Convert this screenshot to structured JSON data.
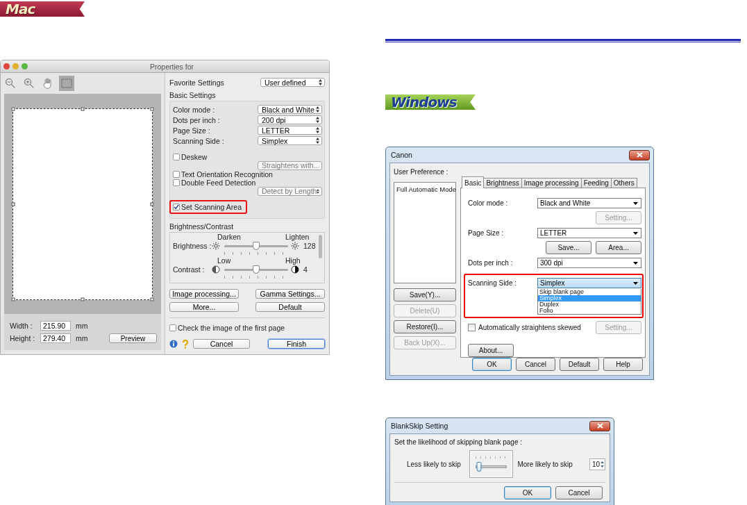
{
  "mac": {
    "badge": {
      "kind": "mac",
      "label": "Mac"
    },
    "dialog": {
      "title": "Properties for",
      "tools": [
        {
          "kind": "zoom_out",
          "selected": false
        },
        {
          "kind": "zoom_in",
          "selected": false
        },
        {
          "kind": "hand",
          "selected": false
        },
        {
          "kind": "select_area",
          "selected": true
        }
      ],
      "size_fields": [
        {
          "label": "Width :",
          "value": "215.90",
          "unit": "mm"
        },
        {
          "label": "Height :",
          "value": "279.40",
          "unit": "mm"
        }
      ],
      "preview_button": "Preview",
      "favorite": {
        "label": "Favorite Settings",
        "value": "User defined"
      },
      "basic_settings": {
        "title": "Basic Settings",
        "popups": [
          {
            "label": "Color mode :",
            "value": "Black and White"
          },
          {
            "label": "Dots per inch :",
            "value": "200 dpi"
          },
          {
            "label": "Page Size :",
            "value": "LETTER"
          },
          {
            "label": "Scanning Side :",
            "value": "Simplex"
          }
        ],
        "options": [
          {
            "kind": "checkbox",
            "label": "Deskew",
            "checked": false
          },
          {
            "kind": "popup",
            "value": "Straightens with...",
            "disabled": true
          },
          {
            "kind": "checkbox",
            "label": "Text Orientation Recognition",
            "checked": false
          },
          {
            "kind": "checkbox",
            "label": "Double Feed Detection",
            "checked": false
          },
          {
            "kind": "popup",
            "value": "Detect by Length",
            "disabled": true
          }
        ]
      },
      "scan_area": {
        "label": "Set Scanning Area",
        "checked": true,
        "highlight": true
      },
      "brightness_contrast": {
        "title": "Brightness/Contrast",
        "sliders": [
          {
            "kind": "brightness",
            "label": "Brightness :",
            "low": "Darken",
            "high": "Lighten",
            "level": 0.5,
            "reading": "128"
          },
          {
            "kind": "contrast",
            "label": "Contrast :",
            "low": "Low",
            "high": "High",
            "level": 0.5,
            "reading": "4"
          }
        ]
      },
      "buttons": [
        {
          "label": "Image processing...",
          "default": false
        },
        {
          "label": "Gamma Settings...",
          "default": false
        },
        {
          "label": "More...",
          "default": false
        },
        {
          "label": "Default",
          "default": false
        }
      ],
      "first_page_check": {
        "label": "Check the image of the first page",
        "checked": false
      },
      "footer_buttons": [
        {
          "label": "Cancel",
          "default": false
        },
        {
          "label": "Finish",
          "default": true
        }
      ]
    }
  },
  "windows": {
    "badge": {
      "kind": "windows",
      "label": "Windows"
    },
    "dialog": {
      "title": "Canon",
      "user_preference": {
        "label": "User Preference :",
        "items": [
          {
            "label": "Full Automatic Mode",
            "selected": false
          }
        ]
      },
      "side_buttons": [
        {
          "label": "Save(Y)...",
          "disabled": false
        },
        {
          "label": "Delete(U)",
          "disabled": true
        },
        {
          "label": "Restore(I)...",
          "disabled": false
        },
        {
          "label": "Back Up(X)...",
          "disabled": true
        }
      ],
      "tabs": [
        {
          "label": "Basic",
          "selected": true
        },
        {
          "label": "Brightness",
          "selected": false
        },
        {
          "label": "Image processing",
          "selected": false
        },
        {
          "label": "Feeding",
          "selected": false
        },
        {
          "label": "Others",
          "selected": false
        }
      ],
      "color_mode": {
        "label": "Color mode :",
        "value": "Black and White"
      },
      "color_setting_button": {
        "label": "Setting...",
        "disabled": true
      },
      "page_size": {
        "label": "Page Size :",
        "value": "LETTER"
      },
      "page_size_buttons": [
        {
          "label": "Save...",
          "disabled": false
        },
        {
          "label": "Area...",
          "disabled": false
        }
      ],
      "dpi": {
        "label": "Dots per inch :",
        "value": "300 dpi"
      },
      "scanning_side": {
        "label": "Scanning Side :",
        "value": "Simplex",
        "highlight": true,
        "options": [
          {
            "label": "Skip blank page",
            "selected": false
          },
          {
            "label": "Simplex",
            "selected": true
          },
          {
            "label": "Duplex",
            "selected": false
          },
          {
            "label": "Folio",
            "selected": false
          }
        ]
      },
      "straighten": {
        "label": "Automatically straightens skewed",
        "checked": false
      },
      "straighten_setting_button": {
        "label": "Setting...",
        "disabled": true
      },
      "about_button": "About...",
      "buttons": [
        {
          "label": "OK",
          "default": true
        },
        {
          "label": "Cancel",
          "default": false
        },
        {
          "label": "Default",
          "default": false
        },
        {
          "label": "Help",
          "default": false
        }
      ]
    },
    "blankskip_dialog": {
      "title": "BlankSkip Setting",
      "prompt": "Set the likelihood of skipping blank page :",
      "low_label": "Less likely to skip",
      "high_label": "More likely to skip",
      "level": 0.1,
      "value": "10",
      "buttons": [
        {
          "label": "OK",
          "default": true
        },
        {
          "label": "Cancel",
          "default": false
        }
      ]
    }
  }
}
